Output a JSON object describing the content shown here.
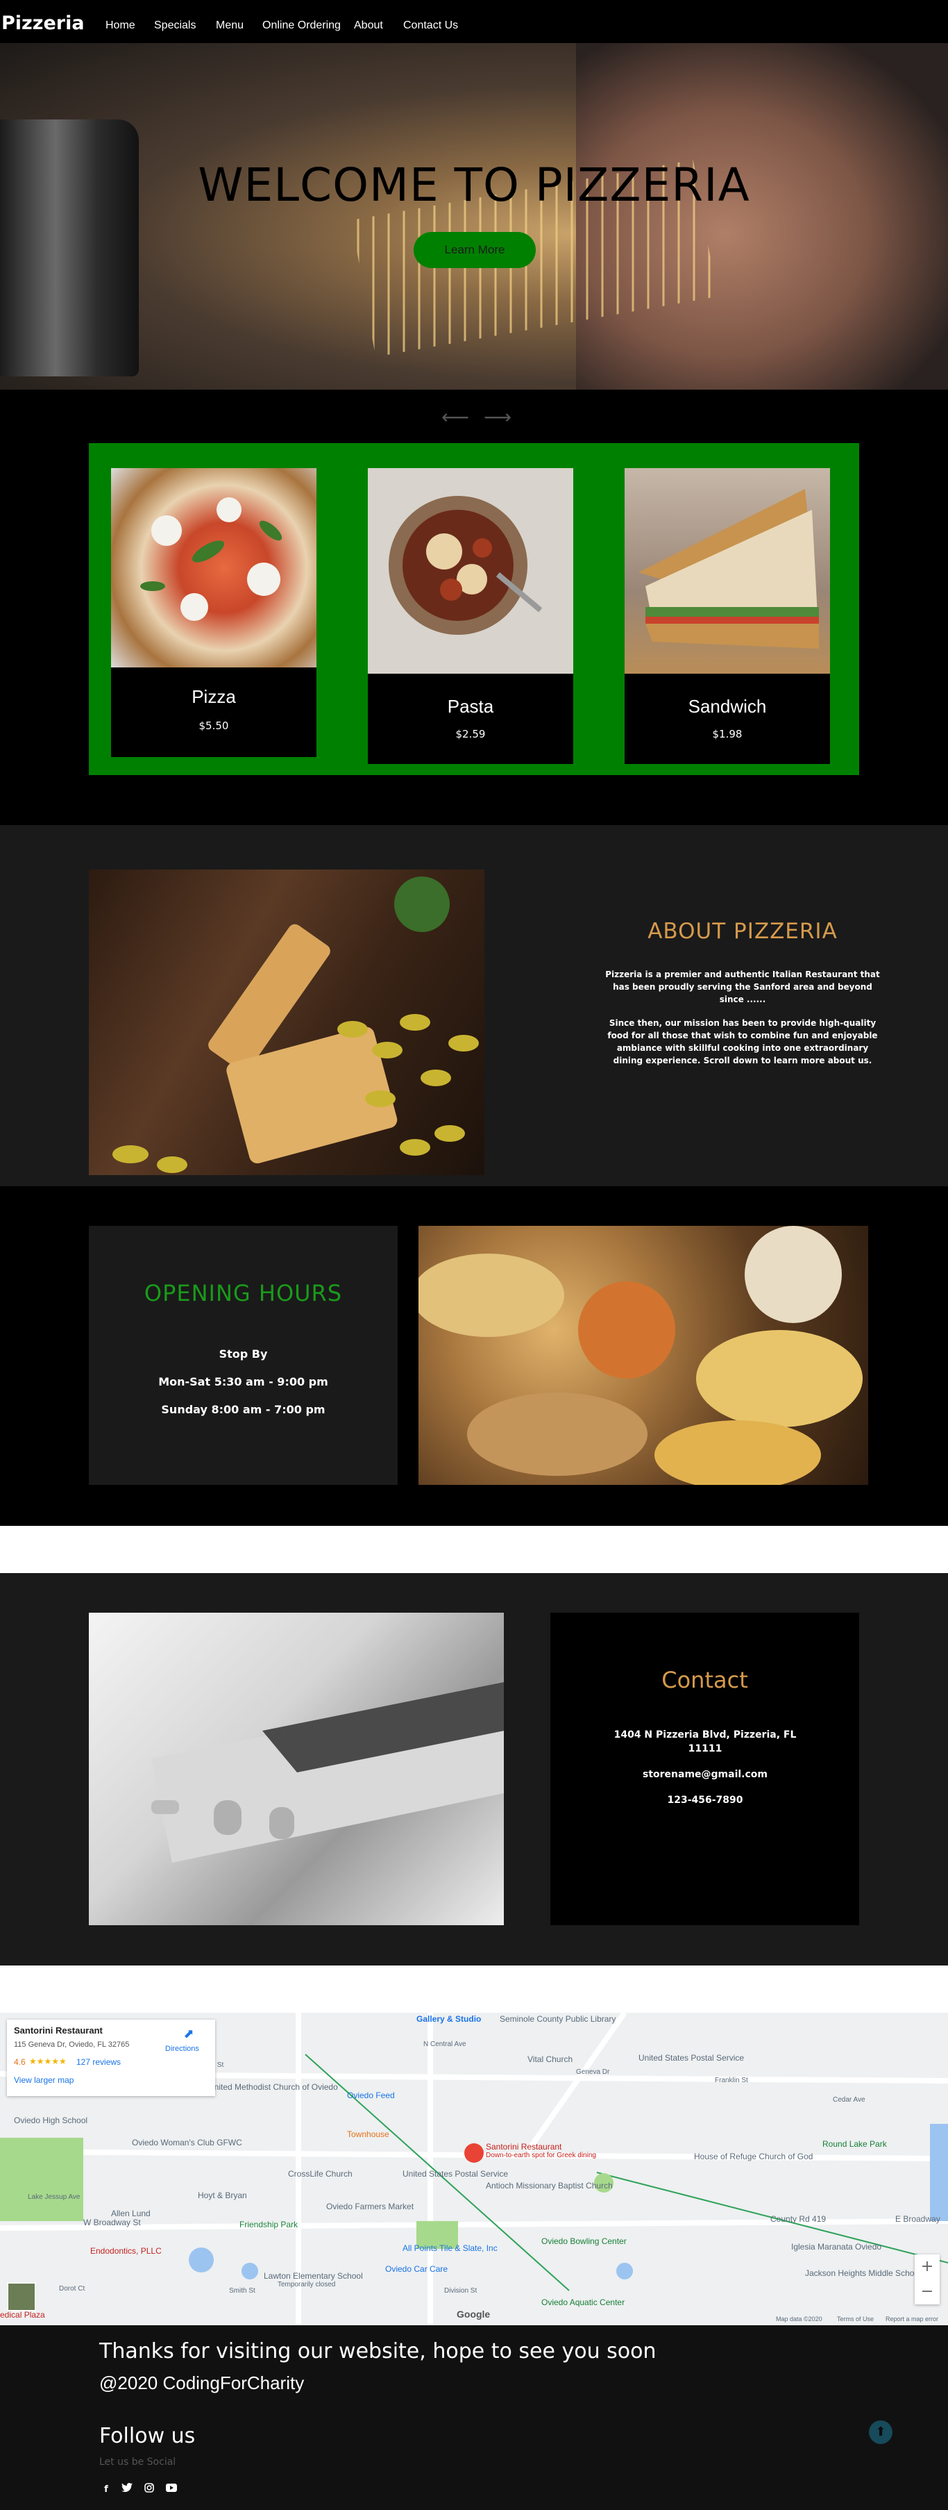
{
  "nav": {
    "brand": "Pizzeria",
    "links": [
      "Home",
      "Specials",
      "Menu",
      "Online Ordering",
      "About",
      "Contact Us"
    ]
  },
  "hero": {
    "title": "WELCOME TO PIZZERIA",
    "button": "Learn More"
  },
  "slider": {
    "prev_icon": "arrow-left-icon",
    "next_icon": "arrow-right-icon"
  },
  "products": [
    {
      "name": "Pizza",
      "price": "$5.50"
    },
    {
      "name": "Pasta",
      "price": "$2.59"
    },
    {
      "name": "Sandwich",
      "price": "$1.98"
    }
  ],
  "about": {
    "title": "ABOUT PIZZERIA",
    "p1": "Pizzeria is a premier and authentic Italian Restaurant that has been proudly serving the Sanford area and beyond since ......",
    "p2": "Since then, our mission has been to provide high-quality food for all those that wish to combine fun and enjoyable ambiance with skillful cooking into one extraordinary dining experience. Scroll down to learn more about us."
  },
  "hours": {
    "title": "OPENING HOURS",
    "lines": [
      "Stop By",
      "Mon-Sat 5:30 am - 9:00 pm",
      "Sunday 8:00 am - 7:00 pm"
    ]
  },
  "contact": {
    "title": "Contact",
    "address": "1404 N Pizzeria Blvd, Pizzeria, FL 11111",
    "email": "storename@gmail.com",
    "phone": "123-456-7890"
  },
  "map": {
    "card": {
      "name": "Santorini Restaurant",
      "address": "115 Geneva Dr, Oviedo, FL 32765",
      "rating": "4.6",
      "stars": "★★★★★",
      "reviews": "127 reviews",
      "directions": "Directions",
      "larger": "View larger map"
    },
    "labels": [
      "Gallery & Studio",
      "Seminole County Public Library",
      "Vital Church",
      "United States Postal Service",
      "United Methodist Church of Oviedo",
      "Oviedo Feed",
      "Oviedo High School",
      "Oviedo Woman's Club GFWC",
      "Townhouse",
      "Santorini Restaurant",
      "Down-to-earth spot for Greek dining",
      "House of Refuge Church of God",
      "Round Lake Park",
      "CrossLife Church",
      "United States Postal Service",
      "Antioch Missionary Baptist Church",
      "Hoyt & Bryan",
      "Oviedo Farmers Market",
      "Friendship Park",
      "Allen Lund",
      "W Broadway St",
      "County Rd 419",
      "E Broadway",
      "Oviedo Bowling Center",
      "Endodontics, PLLC",
      "All Points Tile & Slate, Inc",
      "Lawton Elementary School",
      "Temporarily closed",
      "Oviedo Car Care",
      "Iglesia Maranata Oviedo",
      "Jackson Heights Middle School",
      "Oviedo Aquatic Center",
      "King St",
      "Franklin St",
      "N Central Ave",
      "Geneva Dr",
      "Smith St",
      "Division St",
      "Cedar Ave",
      "Dorot Ct",
      "Lake Jessup Ave",
      "edical Plaza"
    ],
    "footer": [
      "Map data ©2020",
      "Terms of Use",
      "Report a map error"
    ],
    "zoom_in": "+",
    "zoom_out": "−",
    "google": "Google"
  },
  "footer": {
    "thanks": "Thanks for visiting our website, hope to see you soon",
    "copyright": "@2020 CodingForCharity",
    "follow": "Follow us",
    "social_sub": "Let us be Social",
    "social_icons": [
      "facebook-icon",
      "twitter-icon",
      "instagram-icon",
      "youtube-icon"
    ],
    "to_top": "arrow-up-icon"
  },
  "colors": {
    "accent_green": "#008000",
    "accent_orange": "#d69a4c",
    "hours_green": "#1a9a1a"
  }
}
